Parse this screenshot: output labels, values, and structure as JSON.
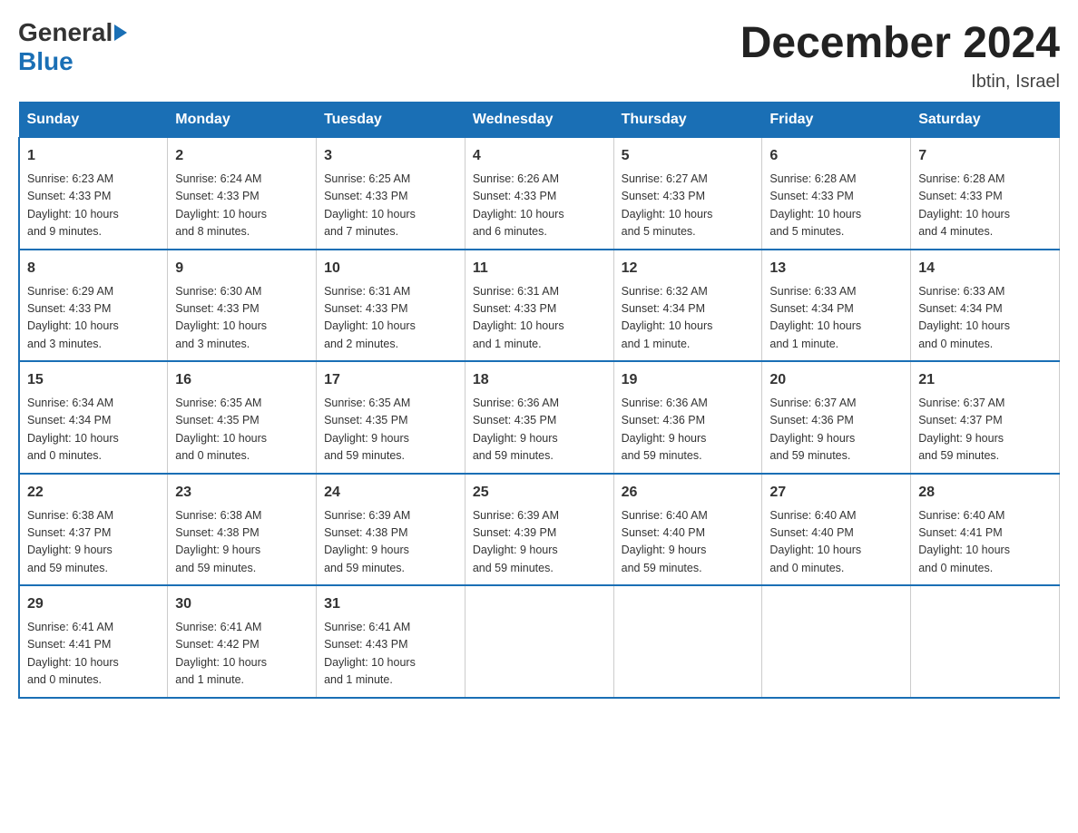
{
  "logo": {
    "general": "General",
    "blue": "Blue"
  },
  "header": {
    "month_year": "December 2024",
    "location": "Ibtin, Israel"
  },
  "weekdays": [
    "Sunday",
    "Monday",
    "Tuesday",
    "Wednesday",
    "Thursday",
    "Friday",
    "Saturday"
  ],
  "weeks": [
    [
      {
        "day": "1",
        "sunrise": "6:23 AM",
        "sunset": "4:33 PM",
        "daylight": "10 hours and 9 minutes."
      },
      {
        "day": "2",
        "sunrise": "6:24 AM",
        "sunset": "4:33 PM",
        "daylight": "10 hours and 8 minutes."
      },
      {
        "day": "3",
        "sunrise": "6:25 AM",
        "sunset": "4:33 PM",
        "daylight": "10 hours and 7 minutes."
      },
      {
        "day": "4",
        "sunrise": "6:26 AM",
        "sunset": "4:33 PM",
        "daylight": "10 hours and 6 minutes."
      },
      {
        "day": "5",
        "sunrise": "6:27 AM",
        "sunset": "4:33 PM",
        "daylight": "10 hours and 5 minutes."
      },
      {
        "day": "6",
        "sunrise": "6:28 AM",
        "sunset": "4:33 PM",
        "daylight": "10 hours and 5 minutes."
      },
      {
        "day": "7",
        "sunrise": "6:28 AM",
        "sunset": "4:33 PM",
        "daylight": "10 hours and 4 minutes."
      }
    ],
    [
      {
        "day": "8",
        "sunrise": "6:29 AM",
        "sunset": "4:33 PM",
        "daylight": "10 hours and 3 minutes."
      },
      {
        "day": "9",
        "sunrise": "6:30 AM",
        "sunset": "4:33 PM",
        "daylight": "10 hours and 3 minutes."
      },
      {
        "day": "10",
        "sunrise": "6:31 AM",
        "sunset": "4:33 PM",
        "daylight": "10 hours and 2 minutes."
      },
      {
        "day": "11",
        "sunrise": "6:31 AM",
        "sunset": "4:33 PM",
        "daylight": "10 hours and 1 minute."
      },
      {
        "day": "12",
        "sunrise": "6:32 AM",
        "sunset": "4:34 PM",
        "daylight": "10 hours and 1 minute."
      },
      {
        "day": "13",
        "sunrise": "6:33 AM",
        "sunset": "4:34 PM",
        "daylight": "10 hours and 1 minute."
      },
      {
        "day": "14",
        "sunrise": "6:33 AM",
        "sunset": "4:34 PM",
        "daylight": "10 hours and 0 minutes."
      }
    ],
    [
      {
        "day": "15",
        "sunrise": "6:34 AM",
        "sunset": "4:34 PM",
        "daylight": "10 hours and 0 minutes."
      },
      {
        "day": "16",
        "sunrise": "6:35 AM",
        "sunset": "4:35 PM",
        "daylight": "10 hours and 0 minutes."
      },
      {
        "day": "17",
        "sunrise": "6:35 AM",
        "sunset": "4:35 PM",
        "daylight": "9 hours and 59 minutes."
      },
      {
        "day": "18",
        "sunrise": "6:36 AM",
        "sunset": "4:35 PM",
        "daylight": "9 hours and 59 minutes."
      },
      {
        "day": "19",
        "sunrise": "6:36 AM",
        "sunset": "4:36 PM",
        "daylight": "9 hours and 59 minutes."
      },
      {
        "day": "20",
        "sunrise": "6:37 AM",
        "sunset": "4:36 PM",
        "daylight": "9 hours and 59 minutes."
      },
      {
        "day": "21",
        "sunrise": "6:37 AM",
        "sunset": "4:37 PM",
        "daylight": "9 hours and 59 minutes."
      }
    ],
    [
      {
        "day": "22",
        "sunrise": "6:38 AM",
        "sunset": "4:37 PM",
        "daylight": "9 hours and 59 minutes."
      },
      {
        "day": "23",
        "sunrise": "6:38 AM",
        "sunset": "4:38 PM",
        "daylight": "9 hours and 59 minutes."
      },
      {
        "day": "24",
        "sunrise": "6:39 AM",
        "sunset": "4:38 PM",
        "daylight": "9 hours and 59 minutes."
      },
      {
        "day": "25",
        "sunrise": "6:39 AM",
        "sunset": "4:39 PM",
        "daylight": "9 hours and 59 minutes."
      },
      {
        "day": "26",
        "sunrise": "6:40 AM",
        "sunset": "4:40 PM",
        "daylight": "9 hours and 59 minutes."
      },
      {
        "day": "27",
        "sunrise": "6:40 AM",
        "sunset": "4:40 PM",
        "daylight": "10 hours and 0 minutes."
      },
      {
        "day": "28",
        "sunrise": "6:40 AM",
        "sunset": "4:41 PM",
        "daylight": "10 hours and 0 minutes."
      }
    ],
    [
      {
        "day": "29",
        "sunrise": "6:41 AM",
        "sunset": "4:41 PM",
        "daylight": "10 hours and 0 minutes."
      },
      {
        "day": "30",
        "sunrise": "6:41 AM",
        "sunset": "4:42 PM",
        "daylight": "10 hours and 1 minute."
      },
      {
        "day": "31",
        "sunrise": "6:41 AM",
        "sunset": "4:43 PM",
        "daylight": "10 hours and 1 minute."
      },
      null,
      null,
      null,
      null
    ]
  ],
  "labels": {
    "sunrise": "Sunrise: ",
    "sunset": "Sunset: ",
    "daylight": "Daylight: "
  }
}
